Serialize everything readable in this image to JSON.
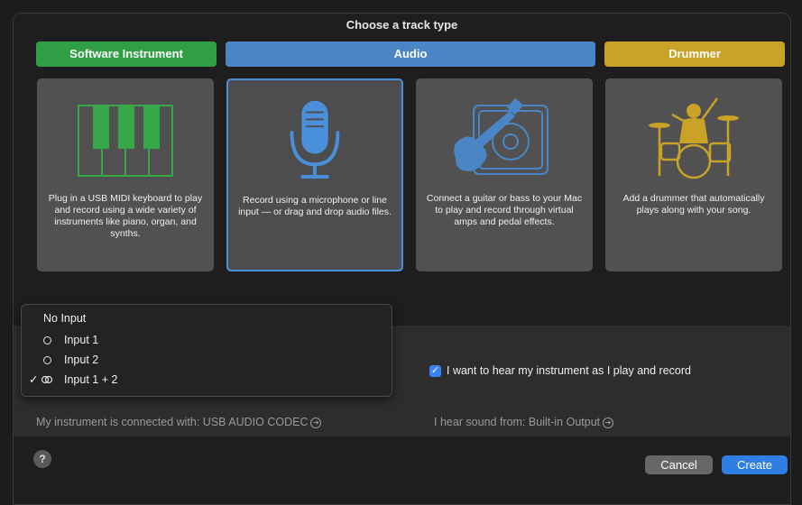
{
  "dialog": {
    "title": "Choose a track type"
  },
  "tabs": [
    {
      "label": "Software Instrument",
      "color": "#2f9e44"
    },
    {
      "label": "Audio",
      "color": "#4a86c5"
    },
    {
      "label": "Drummer",
      "color": "#c9a227"
    }
  ],
  "cards": [
    {
      "icon": "piano-keys-icon",
      "description": "Plug in a USB MIDI keyboard to play and record using a wide variety of instruments like piano, organ, and synths."
    },
    {
      "icon": "microphone-icon",
      "description": "Record using a microphone or line input — or drag and drop audio files."
    },
    {
      "icon": "guitar-amp-icon",
      "description": "Connect a guitar or bass to your Mac to play and record through virtual amps and pedal effects."
    },
    {
      "icon": "drummer-icon",
      "description": "Add a drummer that automatically plays along with your song."
    }
  ],
  "input_menu": {
    "items": [
      {
        "label": "No Input",
        "checked": false
      },
      {
        "label": "Input 1",
        "checked": false
      },
      {
        "label": "Input 2",
        "checked": false
      },
      {
        "label": "Input 1 + 2",
        "checked": true
      }
    ],
    "check_glyph": "✓"
  },
  "monitoring": {
    "label": "I want to hear my instrument as I play and record",
    "checked": true
  },
  "status": {
    "instrument_connection": "My instrument is connected with: USB AUDIO  CODEC",
    "output": "I hear sound from: Built-in Output"
  },
  "footer": {
    "help": "?",
    "cancel": "Cancel",
    "create": "Create"
  }
}
